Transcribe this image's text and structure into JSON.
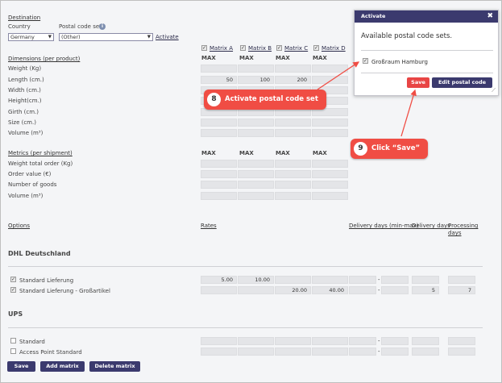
{
  "destination": {
    "section_label": "Destination",
    "country_label": "Country",
    "postal_label": "Postal code sets",
    "country_value": "Germany",
    "postal_value": "(Other)",
    "activate_link": "Activate"
  },
  "matrix_columns": [
    "Matrix A",
    "Matrix B",
    "Matrix C",
    "Matrix D"
  ],
  "max_label": "MAX",
  "dimensions": {
    "title": "Dimensions (per product)",
    "rows": [
      "Weight (Kg)",
      "Length (cm.)",
      "Width (cm.)",
      "Height(cm.)",
      "Girth (cm.)",
      "Size (cm.)",
      "Volume (m³)"
    ],
    "length_values": [
      "50",
      "100",
      "200",
      ""
    ]
  },
  "metrics": {
    "title": "Metrics (per shipment)",
    "rows": [
      "Weight total order (Kg)",
      "Order value (€)",
      "Number of goods",
      "Volume (m³)"
    ]
  },
  "options_header": {
    "options": "Options",
    "rates": "Rates",
    "delivery_days_range": "Delivery days (min-max)",
    "delivery_days": "Delivery days",
    "processing_days_line1": "Processing",
    "processing_days_line2": "days"
  },
  "carriers": [
    {
      "name": "DHL Deutschland",
      "options": [
        {
          "label": "Standard Lieferung",
          "rate_a": "5.00",
          "rate_b": "10.00",
          "rate_c": "",
          "rate_d": "",
          "days": "",
          "proc": ""
        },
        {
          "label": "Standard Lieferung - Großartikel",
          "rate_a": "",
          "rate_b": "",
          "rate_c": "20.00",
          "rate_d": "40.00",
          "days": "5",
          "proc": "7"
        }
      ]
    },
    {
      "name": "UPS",
      "options": [
        {
          "label": "Standard"
        },
        {
          "label": "Access Point Standard"
        }
      ]
    }
  ],
  "range_separator": "-",
  "footer": {
    "save": "Save",
    "add_matrix": "Add matrix",
    "delete_matrix": "Delete matrix"
  },
  "dialog": {
    "title": "Activate",
    "close": "✖",
    "heading": "Available postal code sets.",
    "set_name": "Großraum Hamburg",
    "save": "Save",
    "edit": "Edit postal code sets"
  },
  "callouts": {
    "step8_number": "8",
    "step8_text": "Activate postal code set",
    "step9_number": "9",
    "step9_text": "Click “Save”"
  },
  "colors": {
    "accent": "#3b3a6e",
    "callout": "#f04d44"
  }
}
